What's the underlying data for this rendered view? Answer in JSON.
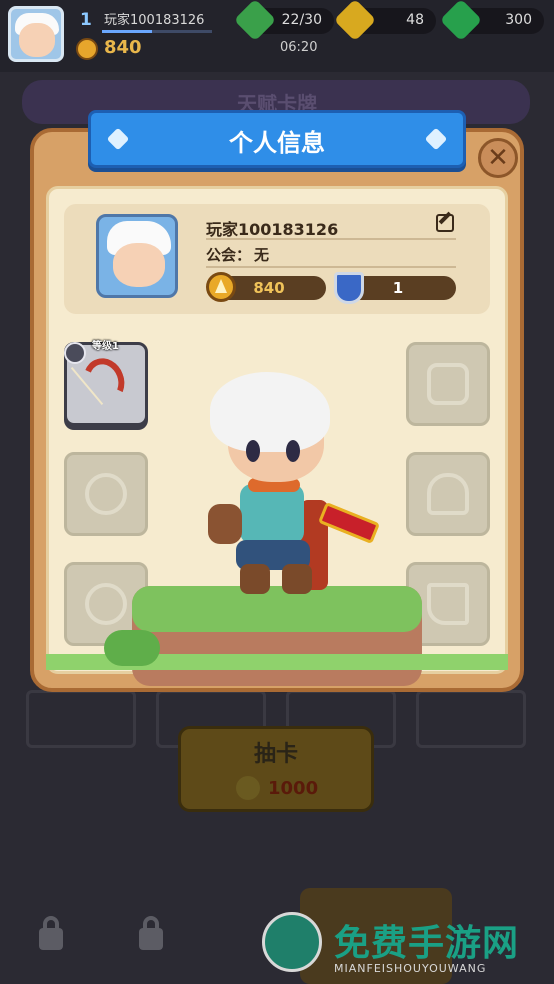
{
  "hud": {
    "level": "1",
    "player_name": "玩家100183126",
    "xp_progress": 0.45,
    "power": "840",
    "energy": "22/30",
    "energy_timer": "06:20",
    "gold": "48",
    "gems": "300"
  },
  "background": {
    "screen_title": "天赋卡牌",
    "draw_button_label": "抽卡",
    "draw_cost": "1000"
  },
  "modal": {
    "title": "个人信息",
    "player_name": "玩家100183126",
    "guild_label": "公会：",
    "guild_value": "无",
    "power": "840",
    "defense": "1"
  },
  "equipment": {
    "weapon_slot_level": "等级1",
    "slots": [
      "armor",
      "helmet",
      "amulet",
      "ring",
      "boots"
    ]
  },
  "watermark": {
    "text": "免费手游网",
    "sub": "MIANFEISHOUYOUWANG"
  },
  "colors": {
    "accent_blue": "#2f8ee8",
    "panel_wood": "#d7a167",
    "panel_cream": "#f6ebcf",
    "power_gold": "#e9a928"
  }
}
